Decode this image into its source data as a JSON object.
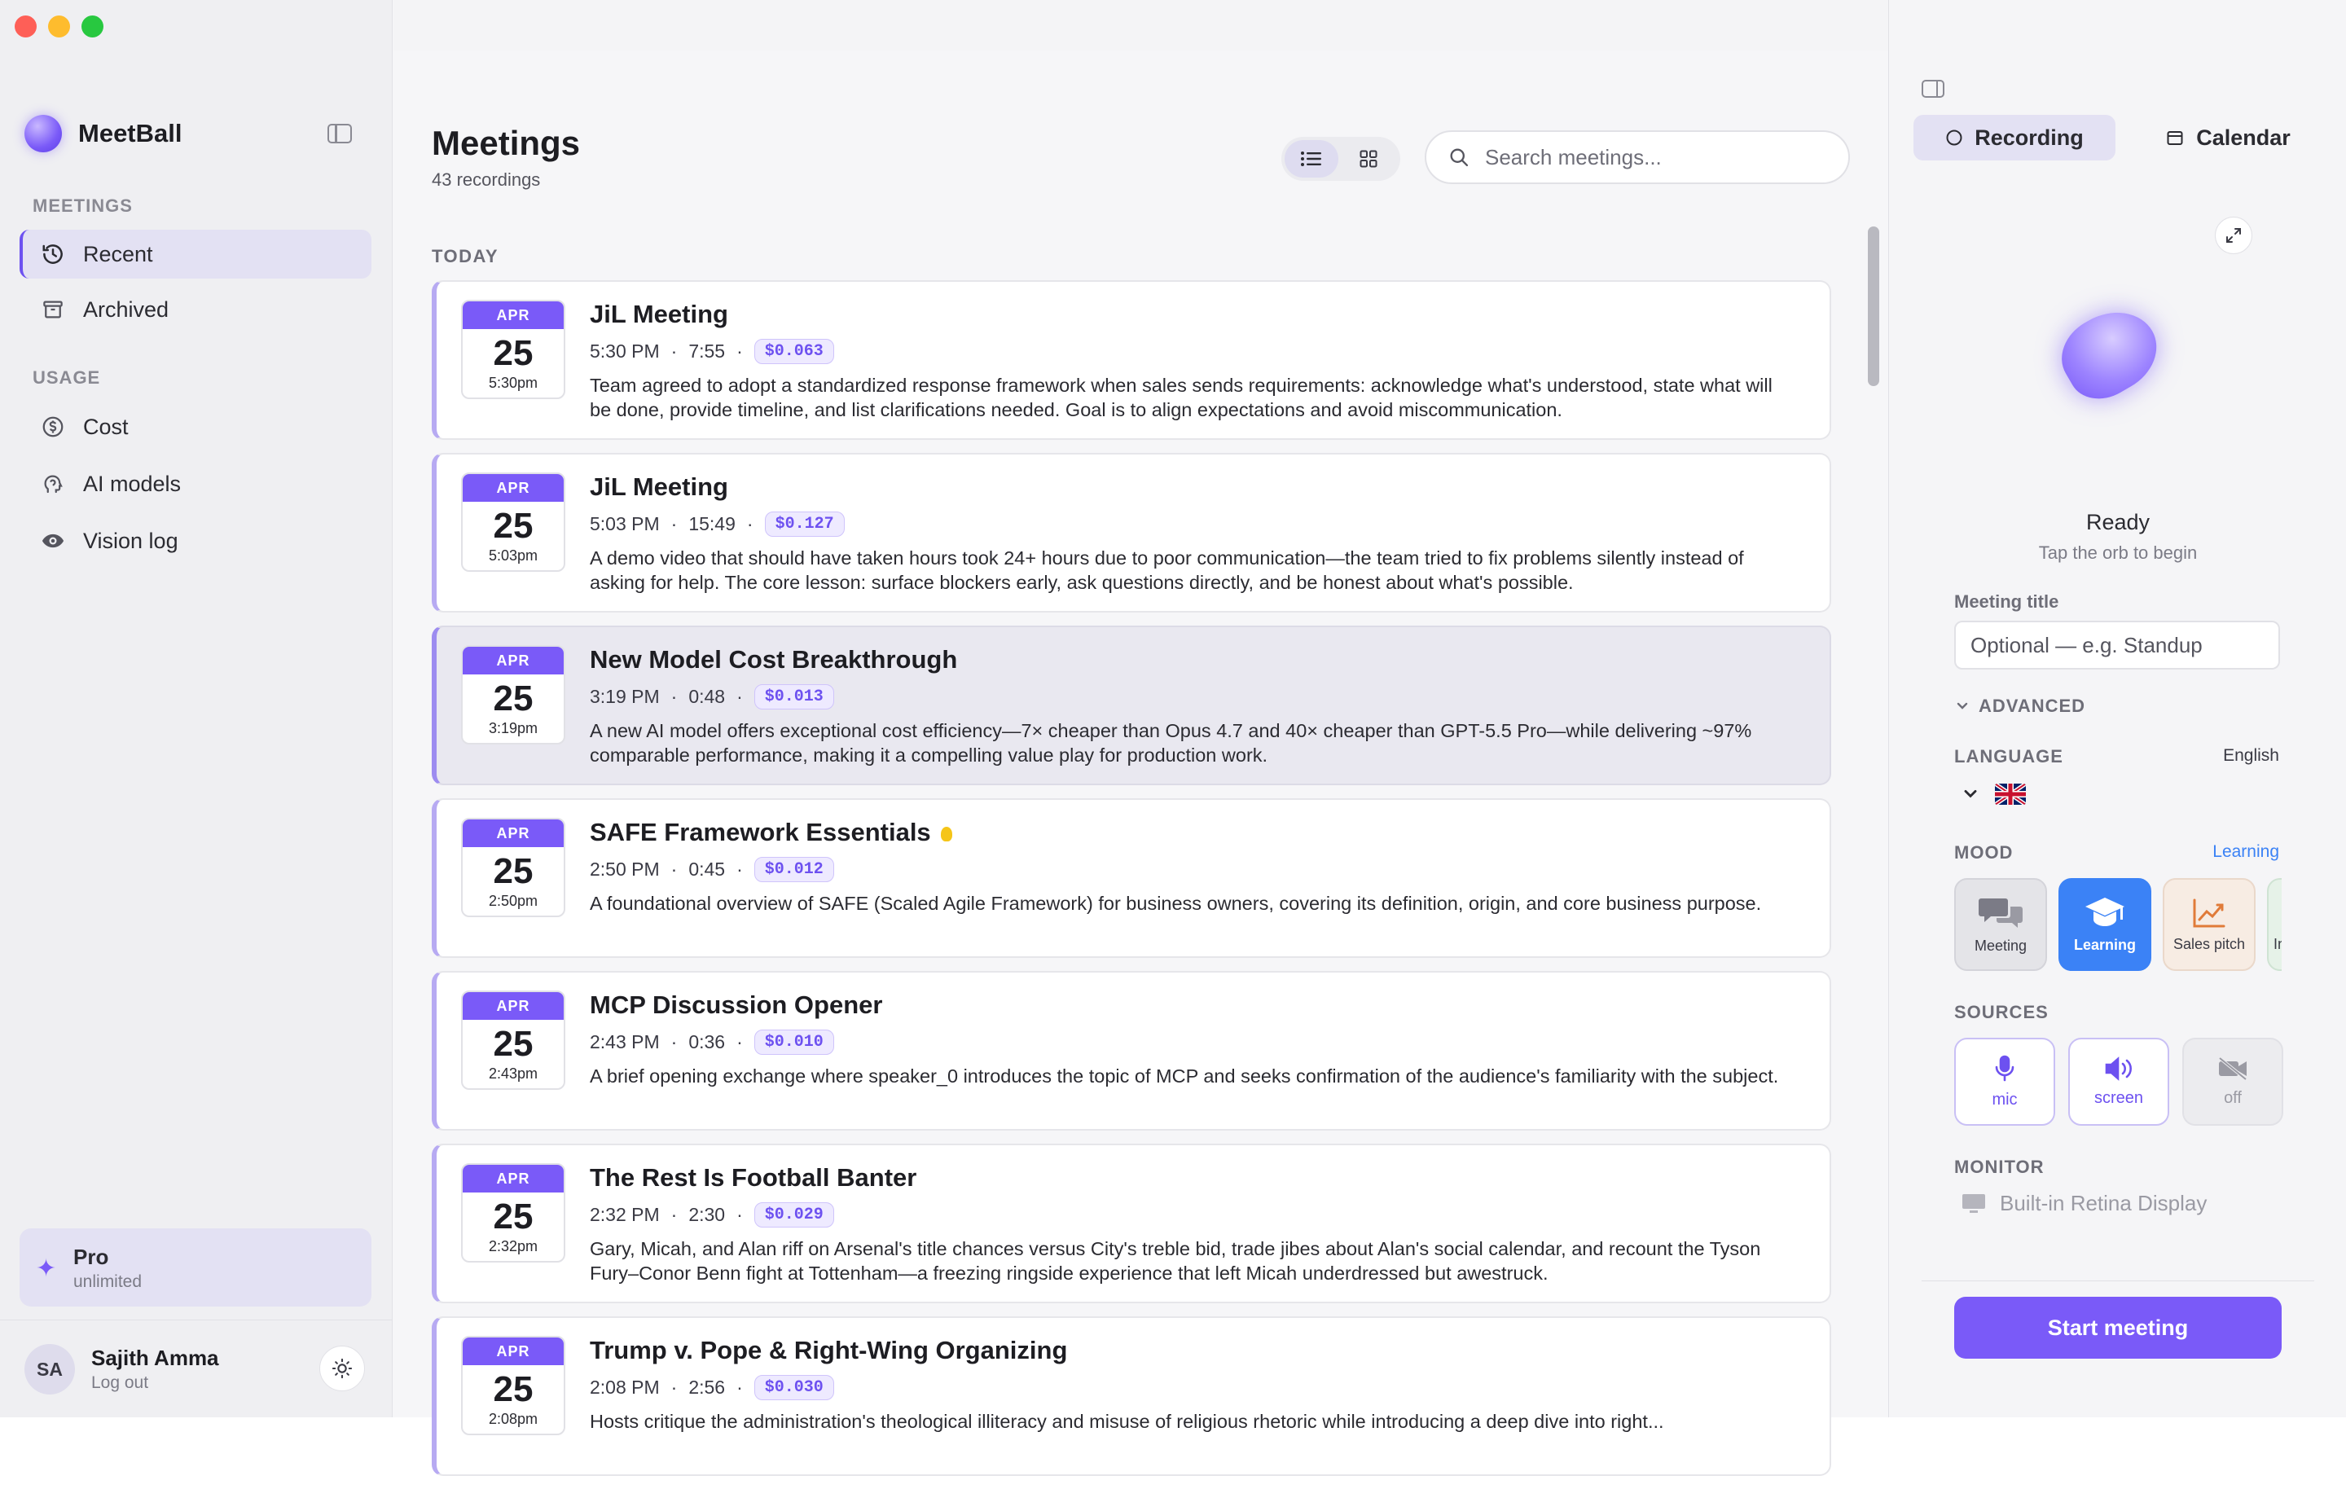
{
  "app": {
    "name": "MeetBall"
  },
  "sidebar": {
    "sections": [
      {
        "label": "MEETINGS",
        "items": [
          {
            "label": "Recent",
            "icon": "history-icon",
            "active": true
          },
          {
            "label": "Archived",
            "icon": "archive-icon"
          }
        ]
      },
      {
        "label": "USAGE",
        "items": [
          {
            "label": "Cost",
            "icon": "dollar-icon"
          },
          {
            "label": "AI models",
            "icon": "head-icon"
          },
          {
            "label": "Vision log",
            "icon": "eye-icon"
          }
        ]
      }
    ],
    "plan": {
      "title": "Pro",
      "subtitle": "unlimited"
    },
    "user": {
      "initials": "SA",
      "name": "Sajith Amma",
      "action": "Log out"
    }
  },
  "main": {
    "title": "Meetings",
    "subtitle": "43 recordings",
    "search": {
      "placeholder": "Search meetings..."
    },
    "group_label": "TODAY",
    "meetings": [
      {
        "month": "APR",
        "day": "25",
        "time_short": "5:30pm",
        "title": "JiL Meeting",
        "time": "5:30 PM",
        "duration": "7:55",
        "cost": "$0.063",
        "summary": "Team agreed to adopt a standardized response framework when sales sends requirements: acknowledge what's understood, state what will be done, provide timeline, and list clarifications needed. Goal is to align expectations and avoid miscommunication."
      },
      {
        "month": "APR",
        "day": "25",
        "time_short": "5:03pm",
        "title": "JiL Meeting",
        "time": "5:03 PM",
        "duration": "15:49",
        "cost": "$0.127",
        "summary": "A demo video that should have taken hours took 24+ hours due to poor communication—the team tried to fix problems silently instead of asking for help. The core lesson: surface blockers early, ask questions directly, and be honest about what's possible."
      },
      {
        "month": "APR",
        "day": "25",
        "time_short": "3:19pm",
        "title": "New Model Cost Breakthrough",
        "time": "3:19 PM",
        "duration": "0:48",
        "cost": "$0.013",
        "summary": "A new AI model offers exceptional cost efficiency—7× cheaper than Opus 4.7 and 40× cheaper than GPT-5.5 Pro—while delivering ~97% comparable performance, making it a compelling value play for production work.",
        "selected": true
      },
      {
        "month": "APR",
        "day": "25",
        "time_short": "2:50pm",
        "title": "SAFE Framework Essentials",
        "time": "2:50 PM",
        "duration": "0:45",
        "cost": "$0.012",
        "summary": "A foundational overview of SAFE (Scaled Agile Framework) for business owners, covering its definition, origin, and core business purpose.",
        "flag": "lightbulb-icon"
      },
      {
        "month": "APR",
        "day": "25",
        "time_short": "2:43pm",
        "title": "MCP Discussion Opener",
        "time": "2:43 PM",
        "duration": "0:36",
        "cost": "$0.010",
        "summary": "A brief opening exchange where speaker_0 introduces the topic of MCP and seeks confirmation of the audience's familiarity with the subject."
      },
      {
        "month": "APR",
        "day": "25",
        "time_short": "2:32pm",
        "title": "The Rest Is Football Banter",
        "time": "2:32 PM",
        "duration": "2:30",
        "cost": "$0.029",
        "summary": "Gary, Micah, and Alan riff on Arsenal's title chances versus City's treble bid, trade jibes about Alan's social calendar, and recount the Tyson Fury–Conor Benn fight at Tottenham—a freezing ringside experience that left Micah underdressed but awestruck."
      },
      {
        "month": "APR",
        "day": "25",
        "time_short": "2:08pm",
        "title": "Trump v. Pope & Right-Wing Organizing",
        "time": "2:08 PM",
        "duration": "2:56",
        "cost": "$0.030",
        "summary": "Hosts critique the administration's theological illiteracy and misuse of religious rhetoric while introducing a deep dive into right..."
      }
    ]
  },
  "panel": {
    "tabs": [
      {
        "label": "Recording",
        "icon": "circle-icon",
        "active": true
      },
      {
        "label": "Calendar",
        "icon": "calendar-icon"
      }
    ],
    "status": "Ready",
    "status_hint": "Tap the orb to begin",
    "title_label": "Meeting title",
    "title_placeholder": "Optional — e.g. Standup",
    "advanced_label": "ADVANCED",
    "language_label": "LANGUAGE",
    "language_value": "English",
    "mood_label": "MOOD",
    "mood_value": "Learning",
    "moods": [
      {
        "label": "Meeting"
      },
      {
        "label": "Learning",
        "active": true
      },
      {
        "label": "Sales pitch"
      },
      {
        "label": "In"
      }
    ],
    "sources_label": "SOURCES",
    "sources": [
      {
        "label": "mic",
        "icon": "mic-icon"
      },
      {
        "label": "screen",
        "icon": "speaker-icon"
      },
      {
        "label": "off",
        "icon": "camera-off-icon"
      }
    ],
    "monitor_label": "MONITOR",
    "monitor_value": "Built-in Retina Display",
    "start_label": "Start meeting"
  },
  "colors": {
    "accent": "#7a5af8",
    "learning": "#3b82f6"
  }
}
